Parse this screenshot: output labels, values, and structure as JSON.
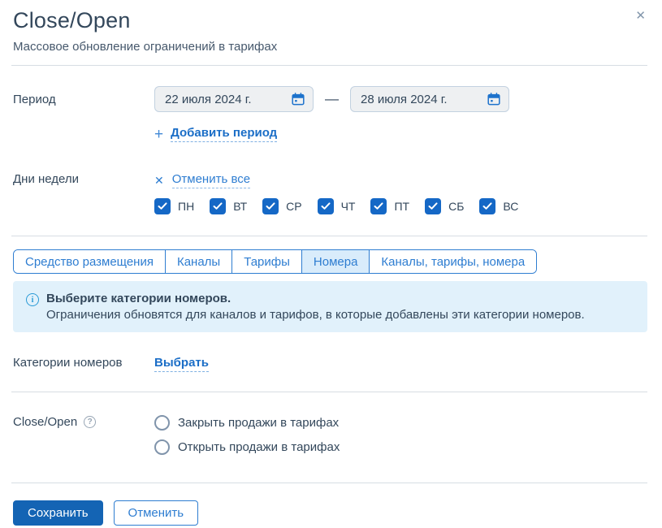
{
  "modal": {
    "title": "Close/Open",
    "subtitle": "Массовое обновление ограничений в тарифах",
    "close_icon": "✕"
  },
  "period": {
    "label": "Период",
    "date_from": "22 июля 2024 г.",
    "date_to": "28 июля 2024 г.",
    "separator": "—",
    "add_plus": "+",
    "add_link": "Добавить период"
  },
  "days": {
    "label": "Дни недели",
    "cancel_icon": "✕",
    "cancel_all": "Отменить все",
    "items": [
      {
        "label": "ПН",
        "checked": true
      },
      {
        "label": "ВТ",
        "checked": true
      },
      {
        "label": "СР",
        "checked": true
      },
      {
        "label": "ЧТ",
        "checked": true
      },
      {
        "label": "ПТ",
        "checked": true
      },
      {
        "label": "СБ",
        "checked": true
      },
      {
        "label": "ВС",
        "checked": true
      }
    ]
  },
  "tabs": [
    {
      "label": "Средство размещения",
      "active": false
    },
    {
      "label": "Каналы",
      "active": false
    },
    {
      "label": "Тарифы",
      "active": false
    },
    {
      "label": "Номера",
      "active": true
    },
    {
      "label": "Каналы, тарифы, номера",
      "active": false
    }
  ],
  "info": {
    "icon": "i",
    "title": "Выберите категории номеров.",
    "text": "Ограничения обновятся для каналов и тарифов, в которые добавлены эти категории номеров."
  },
  "categories": {
    "label": "Категории номеров",
    "select_link": "Выбрать"
  },
  "close_open": {
    "label": "Close/Open",
    "help_icon": "?",
    "options": [
      {
        "label": "Закрыть продажи в тарифах",
        "checked": false
      },
      {
        "label": "Открыть продажи в тарифах",
        "checked": false
      }
    ]
  },
  "footer": {
    "save": "Сохранить",
    "cancel": "Отменить"
  },
  "colors": {
    "accent_blue": "#1464b4",
    "link_blue": "#1b6ec7",
    "tab_blue": "#2e7dd1",
    "checkbox_blue": "#1568c6",
    "active_tab_bg": "#d9ecfb",
    "info_bg": "#e1f1fb",
    "input_bg": "#eef0f2",
    "text_dark": "#33475b",
    "divider": "#d7dde3"
  }
}
